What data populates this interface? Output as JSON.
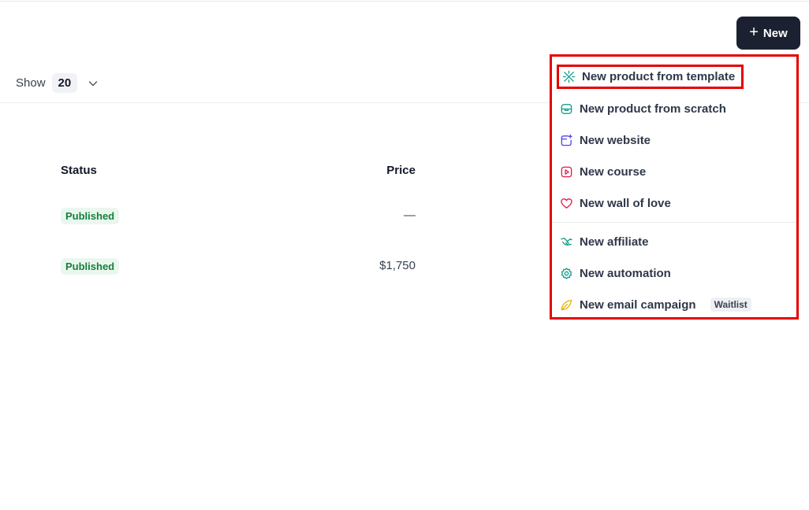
{
  "header": {
    "new_button_label": "New",
    "new_button_icon": "plus-icon"
  },
  "pagination": {
    "show_label": "Show",
    "page_size": "20"
  },
  "table": {
    "columns": {
      "status": "Status",
      "price": "Price"
    },
    "rows": [
      {
        "status": "Published",
        "price": "—"
      },
      {
        "status": "Published",
        "price": "$1,750"
      }
    ]
  },
  "new_menu": {
    "items": [
      {
        "label": "New product from template",
        "icon": "sparkle-template-icon",
        "color": "#0f9d8a"
      },
      {
        "label": "New product from scratch",
        "icon": "box-icon",
        "color": "#0f9d8a"
      },
      {
        "label": "New website",
        "icon": "browser-sparkle-icon",
        "color": "#4f46e5"
      },
      {
        "label": "New course",
        "icon": "play-square-icon",
        "color": "#e11d48"
      },
      {
        "label": "New wall of love",
        "icon": "heart-icon",
        "color": "#e11d48"
      },
      {
        "label": "New affiliate",
        "icon": "handshake-icon",
        "color": "#0f9d8a"
      },
      {
        "label": "New automation",
        "icon": "gear-icon",
        "color": "#0f9d8a"
      },
      {
        "label": "New email campaign",
        "icon": "leaf-send-icon",
        "color": "#eab308",
        "badge": "Waitlist"
      }
    ]
  },
  "colors": {
    "primary_button": "#1b2131",
    "highlight_border": "#e60000",
    "published_badge_bg": "#eaf7ee",
    "published_badge_text": "#15803d"
  }
}
